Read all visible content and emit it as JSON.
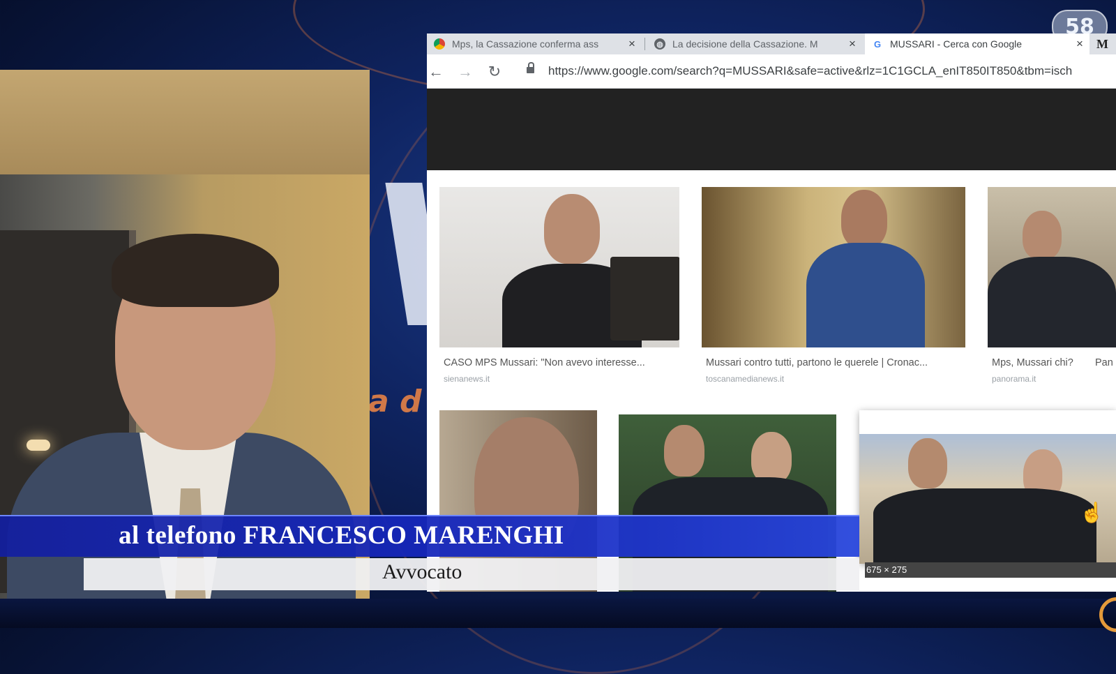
{
  "channel": {
    "logo_text": "58",
    "bg_letter": "V",
    "bg_sub": "a d"
  },
  "browser": {
    "tabs": [
      {
        "title": "Mps, la Cassazione conferma ass",
        "close": "×",
        "favicon": "chrome-icon"
      },
      {
        "title": "La decisione della Cassazione. M",
        "close": "×",
        "favicon": "globe-icon"
      },
      {
        "title": "MUSSARI - Cerca con Google",
        "close": "×",
        "favicon": "google-icon",
        "active": true
      }
    ],
    "next_tab_letter": "M",
    "url": "https://www.google.com/search?q=MUSSARI&safe=active&rlz=1C1GCLA_enIT850IT850&tbm=isch",
    "results": [
      {
        "caption": "CASO MPS Mussari: \"Non avevo interesse...",
        "source": "sienanews.it"
      },
      {
        "caption": "Mussari contro tutti, partono le querele | Cronac...",
        "source": "toscanamedianews.it"
      },
      {
        "caption": "Mps, Mussari chi?",
        "caption_extra": "Pan",
        "source": "panorama.it"
      }
    ],
    "dimension_label": "675 × 275"
  },
  "lower_third": {
    "name_line": "al telefono  FRANCESCO MARENGHI",
    "role": "Avvocato"
  }
}
